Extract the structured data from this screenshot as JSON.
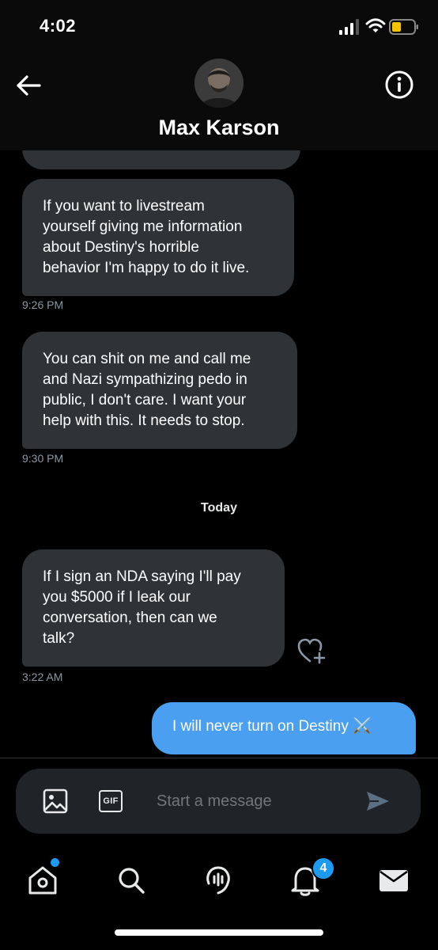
{
  "status_bar": {
    "time": "4:02"
  },
  "header": {
    "contact_name": "Max Karson",
    "back_icon": "arrow-left-icon",
    "info_icon": "info-circle-icon"
  },
  "thread": {
    "messages": [
      {
        "direction": "incoming",
        "text": "If you want to livestream\nyourself giving me information\nabout Destiny's horrible\nbehavior I'm happy to do it live.",
        "time": "9:26 PM"
      },
      {
        "direction": "incoming",
        "text": "You can shit on me and call me\nand Nazi sympathizing pedo in\npublic, I don't care. I want your\nhelp with this. It needs to stop.",
        "time": "9:30 PM"
      },
      {
        "direction": "incoming",
        "text": "If I sign an NDA saying I'll pay\nyou $5000 if I leak our\nconversation, then can we\ntalk?",
        "time": "3:22 AM"
      },
      {
        "direction": "outgoing",
        "text": "I will never turn on Destiny ⚔️"
      }
    ],
    "day_separator": "Today",
    "react_icon": "heart-plus-icon"
  },
  "composer": {
    "placeholder": "Start a message",
    "gif_label": "GIF",
    "image_icon": "image-icon",
    "send_icon": "send-icon"
  },
  "tab_bar": {
    "items": [
      {
        "icon": "home-icon",
        "has_dot": true
      },
      {
        "icon": "search-icon"
      },
      {
        "icon": "spaces-icon"
      },
      {
        "icon": "bell-icon",
        "badge": "4"
      },
      {
        "icon": "mail-icon"
      }
    ]
  },
  "colors": {
    "background": "#000000",
    "incoming_bubble": "#2f3336",
    "outgoing_bubble": "#4a9ff0",
    "accent": "#1d9bf0",
    "battery": "#f5c400"
  }
}
